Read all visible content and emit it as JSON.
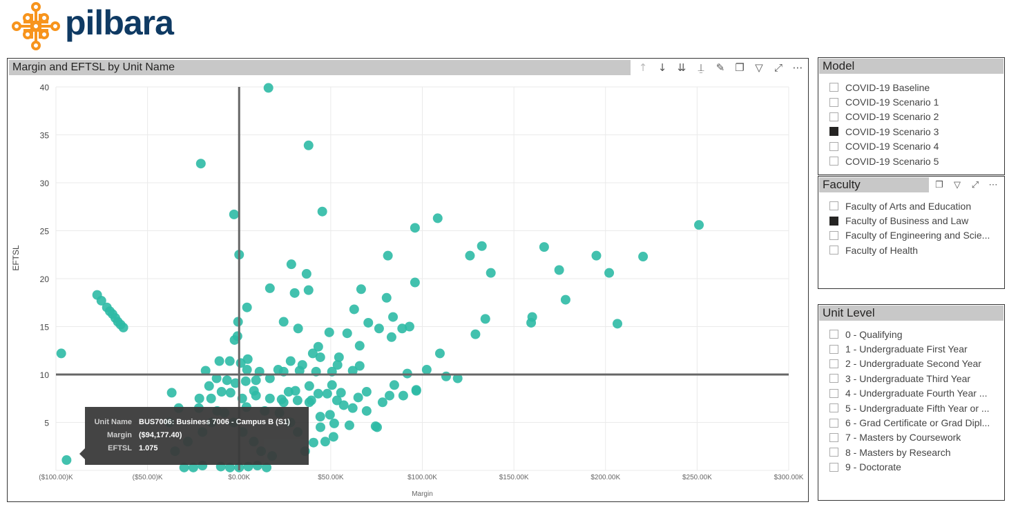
{
  "logo": {
    "text": "pilbara",
    "color": "#0f3a63",
    "mark_color": "#f7941d"
  },
  "visual": {
    "title": "Margin and EFTSL by Unit Name",
    "tools": [
      "drill-up-icon",
      "drill-down-icon",
      "expand-next-level-icon",
      "expand-hierarchy-icon",
      "pin-icon",
      "copy-icon",
      "filter-icon",
      "focus-mode-icon",
      "more-options-icon"
    ]
  },
  "tooltip": {
    "rows": [
      {
        "k": "Unit Name",
        "v": "BUS7006: Business 7006 - Campus B (S1)"
      },
      {
        "k": "Margin",
        "v": "($94,177.40)"
      },
      {
        "k": "EFTSL",
        "v": "1.075"
      }
    ]
  },
  "chart_data": {
    "type": "scatter",
    "title": "Margin and EFTSL by Unit Name",
    "xlabel": "Margin",
    "ylabel": "EFTSL",
    "xlim": [
      -100,
      300
    ],
    "ylim": [
      0,
      40
    ],
    "x_unit": "$K",
    "xticks": [
      -100,
      -50,
      0,
      50,
      100,
      150,
      200,
      250,
      300
    ],
    "xtick_labels": [
      "($100.00)K",
      "($50.00)K",
      "$0.00K",
      "$50.00K",
      "$100.00K",
      "$150.00K",
      "$200.00K",
      "$250.00K",
      "$300.00K"
    ],
    "yticks": [
      5,
      10,
      15,
      20,
      25,
      30,
      35,
      40
    ],
    "ytick_labels": [
      "5",
      "10",
      "15",
      "20",
      "25",
      "30",
      "35",
      "40"
    ],
    "reference_lines": {
      "x": 0,
      "y": 10
    },
    "grid": true,
    "color": "#2ebaa5",
    "points": [
      [
        16,
        39.9
      ],
      [
        37.9,
        33.9
      ],
      [
        -20.9,
        32
      ],
      [
        45.4,
        27
      ],
      [
        -2.8,
        26.7
      ],
      [
        251,
        25.6
      ],
      [
        108.4,
        26.3
      ],
      [
        96,
        25.3
      ],
      [
        132.5,
        23.4
      ],
      [
        126,
        22.4
      ],
      [
        166.5,
        23.3
      ],
      [
        195,
        22.4
      ],
      [
        220.5,
        22.3
      ],
      [
        202,
        20.6
      ],
      [
        174.7,
        20.9
      ],
      [
        137.4,
        20.6
      ],
      [
        81.2,
        22.4
      ],
      [
        0,
        22.5
      ],
      [
        28.5,
        21.5
      ],
      [
        36.8,
        20.5
      ],
      [
        96,
        19.6
      ],
      [
        16.8,
        19
      ],
      [
        66.6,
        18.9
      ],
      [
        37.9,
        18.8
      ],
      [
        30.3,
        18.5
      ],
      [
        178.2,
        17.8
      ],
      [
        80.5,
        18
      ],
      [
        4.3,
        17
      ],
      [
        62.8,
        16.8
      ],
      [
        84,
        16
      ],
      [
        160,
        16
      ],
      [
        159.4,
        15.4
      ],
      [
        134.4,
        15.8
      ],
      [
        206.5,
        15.3
      ],
      [
        24.3,
        15.5
      ],
      [
        -0.6,
        15.5
      ],
      [
        70.5,
        15.4
      ],
      [
        93,
        15
      ],
      [
        89,
        14.8
      ],
      [
        76.4,
        14.8
      ],
      [
        32.2,
        14.8
      ],
      [
        49.2,
        14.4
      ],
      [
        59,
        14.3
      ],
      [
        129,
        14.2
      ],
      [
        83.2,
        13.9
      ],
      [
        -0.9,
        14
      ],
      [
        -2.5,
        13.6
      ],
      [
        65.8,
        13
      ],
      [
        43.2,
        12.9
      ],
      [
        109.6,
        12.2
      ],
      [
        -97.1,
        12.2
      ],
      [
        -77.5,
        18.3
      ],
      [
        -75.2,
        17.7
      ],
      [
        -72.2,
        17
      ],
      [
        -70.6,
        16.6
      ],
      [
        -69.1,
        16.3
      ],
      [
        -67.6,
        15.9
      ],
      [
        -66.2,
        15.5
      ],
      [
        -64.7,
        15.2
      ],
      [
        -63.2,
        14.9
      ],
      [
        -94.2,
        1.075
      ],
      [
        113,
        9.8
      ],
      [
        119.3,
        9.6
      ],
      [
        102.4,
        10.5
      ],
      [
        91.8,
        10.1
      ],
      [
        96.7,
        8.3
      ],
      [
        75.3,
        4.5
      ],
      [
        -36.8,
        8.1
      ],
      [
        -18.3,
        10.4
      ],
      [
        -10.8,
        11.4
      ],
      [
        -5.1,
        11.4
      ],
      [
        0.9,
        11.2
      ],
      [
        4.7,
        11.6
      ],
      [
        4.3,
        10.5
      ],
      [
        11.1,
        10.3
      ],
      [
        21.3,
        10.5
      ],
      [
        28.1,
        11.4
      ],
      [
        34.5,
        11
      ],
      [
        40.2,
        12.2
      ],
      [
        44.3,
        11.8
      ],
      [
        65.8,
        10.9
      ],
      [
        62,
        10.4
      ],
      [
        54.5,
        11.8
      ],
      [
        53.7,
        11
      ],
      [
        50.7,
        10.3
      ],
      [
        42,
        10.3
      ],
      [
        33,
        10.4
      ],
      [
        24.3,
        10.3
      ],
      [
        16.8,
        9.6
      ],
      [
        9.2,
        9.4
      ],
      [
        3.6,
        9.3
      ],
      [
        -2,
        9.1
      ],
      [
        -6.6,
        9.4
      ],
      [
        -12.3,
        9.6
      ],
      [
        -16.4,
        8.8
      ],
      [
        -9.6,
        8.2
      ],
      [
        -4.7,
        8.1
      ],
      [
        -21.7,
        7.5
      ],
      [
        -15.3,
        7.5
      ],
      [
        1.7,
        7.5
      ],
      [
        8.1,
        8.3
      ],
      [
        9.2,
        7.8
      ],
      [
        16.8,
        7.5
      ],
      [
        23.2,
        7.4
      ],
      [
        27,
        8.2
      ],
      [
        30.7,
        8.3
      ],
      [
        31.9,
        7.3
      ],
      [
        38.3,
        8.8
      ],
      [
        39.4,
        7.3
      ],
      [
        43.2,
        8
      ],
      [
        48.1,
        8
      ],
      [
        50.7,
        8.9
      ],
      [
        55.6,
        8.1
      ],
      [
        53.4,
        7.3
      ],
      [
        57.1,
        6.8
      ],
      [
        62,
        6.5
      ],
      [
        69.6,
        6.2
      ],
      [
        65,
        7.6
      ],
      [
        69.6,
        8.2
      ],
      [
        78.3,
        7.1
      ],
      [
        82.1,
        7.8
      ],
      [
        84.7,
        8.9
      ],
      [
        89.6,
        7.8
      ],
      [
        96.7,
        8.4
      ],
      [
        74.5,
        4.6
      ],
      [
        60.2,
        4.7
      ],
      [
        51.5,
        3.5
      ],
      [
        47,
        3
      ],
      [
        40.6,
        2.9
      ],
      [
        44.4,
        4.5
      ],
      [
        51.9,
        4.9
      ],
      [
        44.3,
        5.6
      ],
      [
        49.6,
        5.8
      ],
      [
        38.3,
        7.1
      ],
      [
        24.3,
        7.1
      ],
      [
        -30,
        0.3
      ],
      [
        -25,
        0.3
      ],
      [
        -20,
        0.5
      ],
      [
        -10,
        0.4
      ],
      [
        -5,
        0.3
      ],
      [
        0,
        0.3
      ],
      [
        5,
        0.4
      ],
      [
        10,
        0.5
      ],
      [
        15,
        0.3
      ],
      [
        -35,
        2
      ],
      [
        -28,
        3
      ],
      [
        -20,
        4
      ],
      [
        -15,
        5
      ],
      [
        -8,
        6
      ],
      [
        -3,
        5
      ],
      [
        2,
        4
      ],
      [
        8,
        3
      ],
      [
        12,
        2
      ],
      [
        18,
        1.5
      ],
      [
        22,
        6
      ],
      [
        28,
        5
      ],
      [
        32,
        4
      ],
      [
        36,
        2
      ],
      [
        -22,
        6.5
      ],
      [
        -12,
        6.2
      ],
      [
        4,
        6.6
      ],
      [
        14,
        6.2
      ],
      [
        -38,
        5
      ],
      [
        -33,
        6.5
      ]
    ]
  },
  "slicers": {
    "model": {
      "title": "Model",
      "items": [
        {
          "label": "COVID-19 Baseline",
          "checked": false
        },
        {
          "label": "COVID-19 Scenario 1",
          "checked": false
        },
        {
          "label": "COVID-19 Scenario 2",
          "checked": false
        },
        {
          "label": "COVID-19 Scenario 3",
          "checked": true
        },
        {
          "label": "COVID-19 Scenario 4",
          "checked": false
        },
        {
          "label": "COVID-19 Scenario 5",
          "checked": false
        }
      ]
    },
    "faculty": {
      "title": "Faculty",
      "items": [
        {
          "label": "Faculty of Arts and Education",
          "checked": false
        },
        {
          "label": "Faculty of Business and Law",
          "checked": true
        },
        {
          "label": "Faculty of Engineering and Scie...",
          "checked": false
        },
        {
          "label": "Faculty of Health",
          "checked": false
        }
      ]
    },
    "unit_level": {
      "title": "Unit Level",
      "items": [
        {
          "label": "0 - Qualifying",
          "checked": false
        },
        {
          "label": "1 - Undergraduate First Year",
          "checked": false
        },
        {
          "label": "2 - Undergraduate Second Year",
          "checked": false
        },
        {
          "label": "3 - Undergraduate Third Year",
          "checked": false
        },
        {
          "label": "4 - Undergraduate Fourth Year ...",
          "checked": false
        },
        {
          "label": "5 - Undergraduate Fifth Year or ...",
          "checked": false
        },
        {
          "label": "6 - Grad Certificate or Grad Dipl...",
          "checked": false
        },
        {
          "label": "7 - Masters by Coursework",
          "checked": false
        },
        {
          "label": "8 - Masters by Research",
          "checked": false
        },
        {
          "label": "9 - Doctorate",
          "checked": false
        }
      ]
    }
  }
}
